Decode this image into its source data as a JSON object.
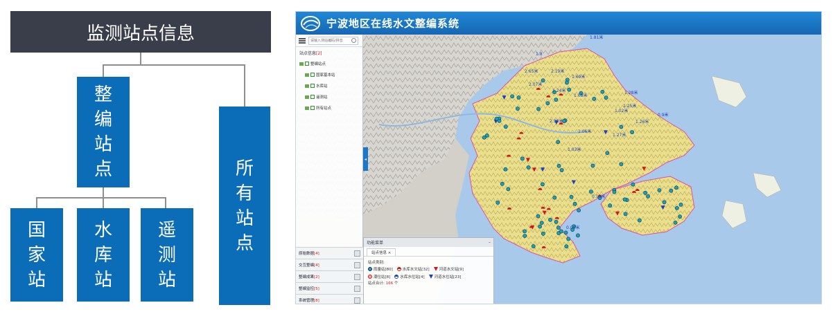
{
  "org_chart": {
    "root": "监测站点信息",
    "branch_a": "整编站点",
    "branch_b": "所有站点",
    "children": [
      "国家站",
      "水库站",
      "遥测站"
    ]
  },
  "app": {
    "title": "宁波地区在线水文整编系统",
    "search_placeholder": "请输入测站编码/拼音",
    "tree_title": "站点信息",
    "tree_count": "[2]",
    "tree_items": [
      "整编站点",
      "国家基本站",
      "水库站",
      "遥测站",
      "所有站点"
    ],
    "bottom_items": [
      {
        "label": "原始数据",
        "count": "[4]"
      },
      {
        "label": "交互整编",
        "count": "[4]"
      },
      {
        "label": "整编成果",
        "count": "[2]"
      },
      {
        "label": "整编监控",
        "count": "[5]"
      },
      {
        "label": "系统管理",
        "count": "[8]"
      }
    ],
    "legend": {
      "header": "功能菜单",
      "tab": "站点信息",
      "tab_close": "×",
      "caption": "站点类别:",
      "rows": [
        [
          {
            "sym": "rain",
            "label": "雨量站[80]"
          },
          {
            "sym": "reservoir",
            "label": "水库水文站[32]"
          },
          {
            "sym": "river",
            "label": "河道水文站[9]"
          }
        ],
        [
          {
            "sym": "tide",
            "label": "潮位站[8]"
          },
          {
            "sym": "reservoir-level",
            "label": "水库水位站[4]"
          },
          {
            "sym": "river-level",
            "label": "河道水位站[23]"
          }
        ]
      ],
      "total_label": "站点合计:",
      "total_value": "166",
      "total_unit": "个"
    },
    "map_labels": [
      "1.81米",
      "1.8",
      "2.65米",
      "2.19米",
      "1.69米",
      "2.07米",
      "1.24米",
      "1.08米",
      "1.28米",
      "1.25米",
      "1.02米",
      "0.9米",
      "2.38米",
      "1.26米",
      "1.06米",
      "1.27米",
      "1.03米",
      "0.18米",
      "0.00米"
    ],
    "colors": {
      "header": "#1a74c4",
      "land": "#f1e8a0",
      "sea": "#a9c9ea",
      "rain": "#1aa0b8",
      "red": "#d01818",
      "blue": "#1c3fc0"
    }
  }
}
